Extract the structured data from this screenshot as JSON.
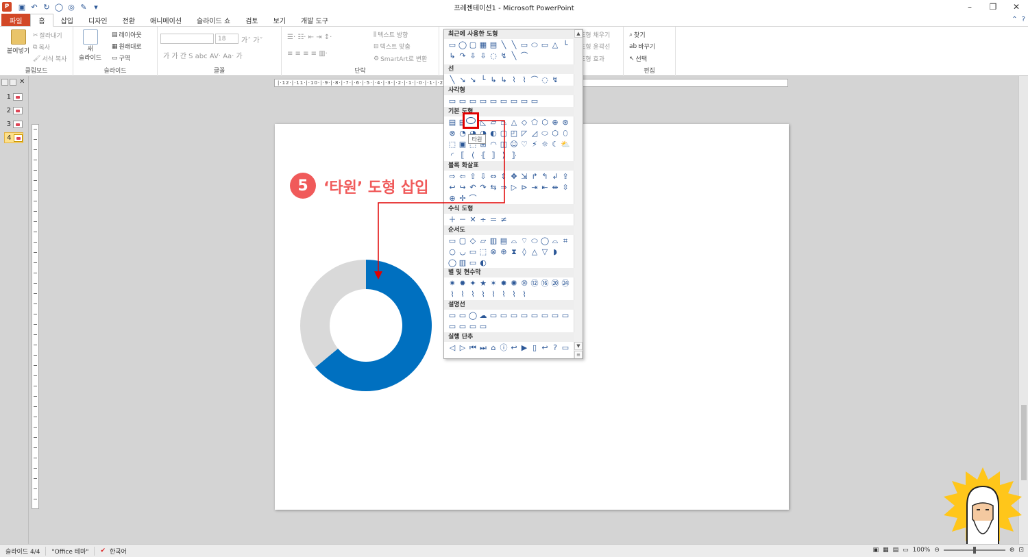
{
  "app": {
    "window_title": "프레젠테이션1 - Microsoft PowerPoint",
    "icon_letter": "P"
  },
  "tabs": [
    {
      "label": "파일"
    },
    {
      "label": "홈"
    },
    {
      "label": "삽입"
    },
    {
      "label": "디자인"
    },
    {
      "label": "전환"
    },
    {
      "label": "애니메이션"
    },
    {
      "label": "슬라이드 쇼"
    },
    {
      "label": "검토"
    },
    {
      "label": "보기"
    },
    {
      "label": "개발 도구"
    }
  ],
  "ribbon": {
    "clipboard": {
      "paste": "붙여넣기",
      "cut": "잘라내기",
      "copy": "복사",
      "format_painter": "서식 복사",
      "label": "클립보드"
    },
    "slides": {
      "new_slide_line1": "새",
      "new_slide_line2": "슬라이드",
      "layout": "레이아웃",
      "reset": "원래대로",
      "section": "구역",
      "label": "슬라이드"
    },
    "font": {
      "size": "18",
      "label": "글꼴"
    },
    "paragraph": {
      "text_direction": "텍스트 방향",
      "align_text": "텍스트 맞춤",
      "smartart": "SmartArt로 변환",
      "label": "단락"
    },
    "drawing": {
      "shape_fill": "도형 채우기",
      "shape_outline": "도형 윤곽선",
      "shape_effects": "도형 효과"
    },
    "editing": {
      "find": "찾기",
      "replace": "바꾸기",
      "select": "선택",
      "label": "편집"
    }
  },
  "slides_pane": {
    "items": [
      {
        "num": "1"
      },
      {
        "num": "2"
      },
      {
        "num": "3"
      },
      {
        "num": "4"
      }
    ]
  },
  "ruler_text": "|·12·|·11·|·10·|·9·|·8·|·7·|·6·|·5·|·4·|·3·|·2·|·1·|·0·|·1·|·2·|·3·|·4·|·5·|·6·|·7·|·8·|·9·|·10·|·11·|·12·|",
  "gallery": {
    "sections": [
      {
        "title": "최근에 사용한 도형"
      },
      {
        "title": "선"
      },
      {
        "title": "사각형"
      },
      {
        "title": "기본 도형"
      },
      {
        "title": "블록 화살표"
      },
      {
        "title": "수식 도형"
      },
      {
        "title": "순서도"
      },
      {
        "title": "별 및 현수막"
      },
      {
        "title": "설명선"
      },
      {
        "title": "실행 단추"
      }
    ],
    "tooltip": "타원"
  },
  "annotation": {
    "step": "5",
    "text": "‘타원’ 도형 삽입",
    "color": "#f05a5a"
  },
  "chart_data": {
    "type": "pie",
    "values": [
      64,
      36
    ],
    "colors": [
      "#0070c0",
      "#d9d9d9"
    ]
  },
  "statusbar": {
    "slide": "슬라이드 4/4",
    "theme": "\"Office 테마\"",
    "language": "한국어",
    "zoom": "100%"
  }
}
